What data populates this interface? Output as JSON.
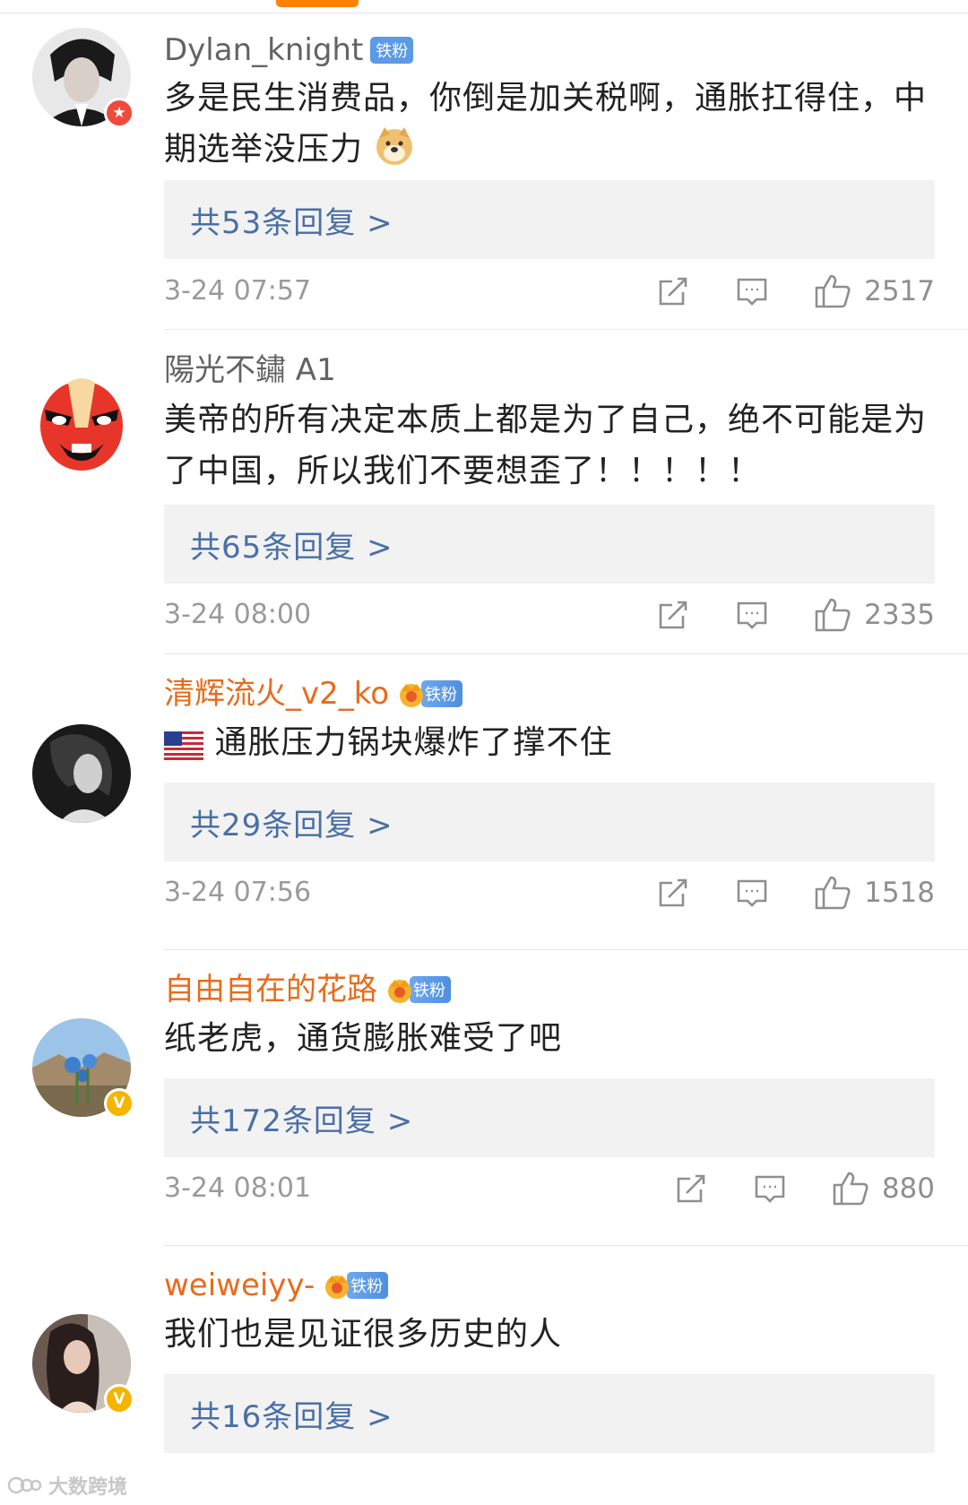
{
  "comments": [
    {
      "username": "Dylan_knight",
      "fan_tag": "铁粉",
      "text": "多是民生消费品，你倒是加关税啊，通胀扛得住，中期选举没压力",
      "emoji": "doge-icon",
      "reply_link": "共53条回复 >",
      "timestamp": "3-24 07:57",
      "likes": "2517",
      "badge": "red"
    },
    {
      "username": "陽光不鏽 A1",
      "fan_tag": "",
      "text": "美帝的所有决定本质上都是为了自己，绝不可能是为了中国，所以我们不要想歪了！！！！！",
      "reply_link": "共65条回复 >",
      "timestamp": "3-24 08:00",
      "likes": "2335"
    },
    {
      "username": "清辉流火_v2_ko",
      "fan_tag": "铁粉",
      "text": "通胀压力锅块爆炸了撑不住",
      "emoji": "us-flag-icon",
      "reply_link": "共29条回复 >",
      "timestamp": "3-24 07:56",
      "likes": "1518"
    },
    {
      "username": "自由自在的花路",
      "fan_tag": "铁粉",
      "text": "纸老虎，通货膨胀难受了吧",
      "reply_link": "共172条回复 >",
      "timestamp": "3-24 08:01",
      "likes": "880",
      "badge": "gold"
    },
    {
      "username": "weiweiyy-",
      "fan_tag": "铁粉",
      "text": "我们也是见证很多历史的人",
      "reply_link": "共16条回复 >",
      "badge": "gold"
    }
  ],
  "watermark": "大数跨境",
  "colors": {
    "accent": "#ff8200",
    "vip_name": "#e86b1c",
    "reply_link": "#4a6fa5",
    "fan_tag": "#5b9ae6"
  }
}
